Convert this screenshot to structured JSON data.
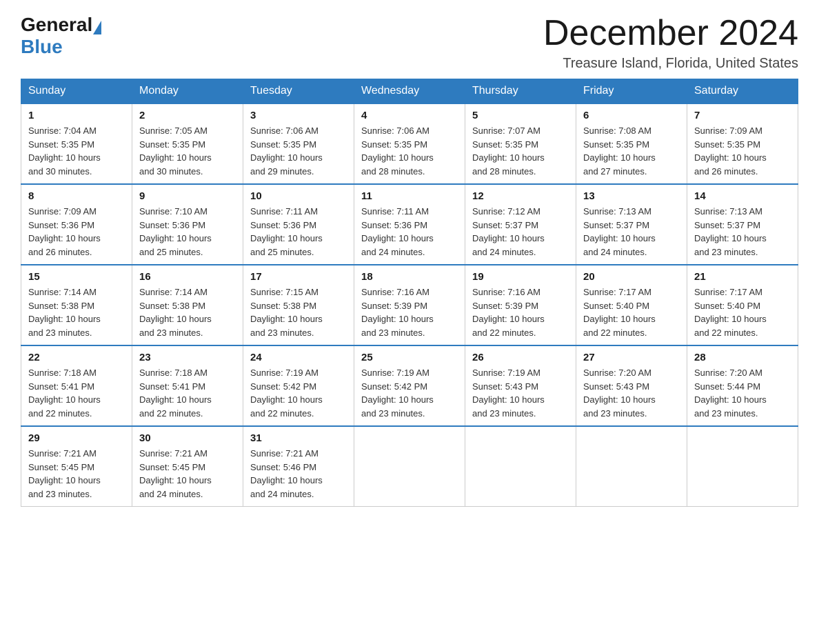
{
  "logo": {
    "general_text": "General",
    "blue_text": "Blue"
  },
  "header": {
    "month_title": "December 2024",
    "location": "Treasure Island, Florida, United States"
  },
  "weekdays": [
    "Sunday",
    "Monday",
    "Tuesday",
    "Wednesday",
    "Thursday",
    "Friday",
    "Saturday"
  ],
  "weeks": [
    [
      {
        "day": "1",
        "sunrise": "7:04 AM",
        "sunset": "5:35 PM",
        "daylight": "10 hours and 30 minutes."
      },
      {
        "day": "2",
        "sunrise": "7:05 AM",
        "sunset": "5:35 PM",
        "daylight": "10 hours and 30 minutes."
      },
      {
        "day": "3",
        "sunrise": "7:06 AM",
        "sunset": "5:35 PM",
        "daylight": "10 hours and 29 minutes."
      },
      {
        "day": "4",
        "sunrise": "7:06 AM",
        "sunset": "5:35 PM",
        "daylight": "10 hours and 28 minutes."
      },
      {
        "day": "5",
        "sunrise": "7:07 AM",
        "sunset": "5:35 PM",
        "daylight": "10 hours and 28 minutes."
      },
      {
        "day": "6",
        "sunrise": "7:08 AM",
        "sunset": "5:35 PM",
        "daylight": "10 hours and 27 minutes."
      },
      {
        "day": "7",
        "sunrise": "7:09 AM",
        "sunset": "5:35 PM",
        "daylight": "10 hours and 26 minutes."
      }
    ],
    [
      {
        "day": "8",
        "sunrise": "7:09 AM",
        "sunset": "5:36 PM",
        "daylight": "10 hours and 26 minutes."
      },
      {
        "day": "9",
        "sunrise": "7:10 AM",
        "sunset": "5:36 PM",
        "daylight": "10 hours and 25 minutes."
      },
      {
        "day": "10",
        "sunrise": "7:11 AM",
        "sunset": "5:36 PM",
        "daylight": "10 hours and 25 minutes."
      },
      {
        "day": "11",
        "sunrise": "7:11 AM",
        "sunset": "5:36 PM",
        "daylight": "10 hours and 24 minutes."
      },
      {
        "day": "12",
        "sunrise": "7:12 AM",
        "sunset": "5:37 PM",
        "daylight": "10 hours and 24 minutes."
      },
      {
        "day": "13",
        "sunrise": "7:13 AM",
        "sunset": "5:37 PM",
        "daylight": "10 hours and 24 minutes."
      },
      {
        "day": "14",
        "sunrise": "7:13 AM",
        "sunset": "5:37 PM",
        "daylight": "10 hours and 23 minutes."
      }
    ],
    [
      {
        "day": "15",
        "sunrise": "7:14 AM",
        "sunset": "5:38 PM",
        "daylight": "10 hours and 23 minutes."
      },
      {
        "day": "16",
        "sunrise": "7:14 AM",
        "sunset": "5:38 PM",
        "daylight": "10 hours and 23 minutes."
      },
      {
        "day": "17",
        "sunrise": "7:15 AM",
        "sunset": "5:38 PM",
        "daylight": "10 hours and 23 minutes."
      },
      {
        "day": "18",
        "sunrise": "7:16 AM",
        "sunset": "5:39 PM",
        "daylight": "10 hours and 23 minutes."
      },
      {
        "day": "19",
        "sunrise": "7:16 AM",
        "sunset": "5:39 PM",
        "daylight": "10 hours and 22 minutes."
      },
      {
        "day": "20",
        "sunrise": "7:17 AM",
        "sunset": "5:40 PM",
        "daylight": "10 hours and 22 minutes."
      },
      {
        "day": "21",
        "sunrise": "7:17 AM",
        "sunset": "5:40 PM",
        "daylight": "10 hours and 22 minutes."
      }
    ],
    [
      {
        "day": "22",
        "sunrise": "7:18 AM",
        "sunset": "5:41 PM",
        "daylight": "10 hours and 22 minutes."
      },
      {
        "day": "23",
        "sunrise": "7:18 AM",
        "sunset": "5:41 PM",
        "daylight": "10 hours and 22 minutes."
      },
      {
        "day": "24",
        "sunrise": "7:19 AM",
        "sunset": "5:42 PM",
        "daylight": "10 hours and 22 minutes."
      },
      {
        "day": "25",
        "sunrise": "7:19 AM",
        "sunset": "5:42 PM",
        "daylight": "10 hours and 23 minutes."
      },
      {
        "day": "26",
        "sunrise": "7:19 AM",
        "sunset": "5:43 PM",
        "daylight": "10 hours and 23 minutes."
      },
      {
        "day": "27",
        "sunrise": "7:20 AM",
        "sunset": "5:43 PM",
        "daylight": "10 hours and 23 minutes."
      },
      {
        "day": "28",
        "sunrise": "7:20 AM",
        "sunset": "5:44 PM",
        "daylight": "10 hours and 23 minutes."
      }
    ],
    [
      {
        "day": "29",
        "sunrise": "7:21 AM",
        "sunset": "5:45 PM",
        "daylight": "10 hours and 23 minutes."
      },
      {
        "day": "30",
        "sunrise": "7:21 AM",
        "sunset": "5:45 PM",
        "daylight": "10 hours and 24 minutes."
      },
      {
        "day": "31",
        "sunrise": "7:21 AM",
        "sunset": "5:46 PM",
        "daylight": "10 hours and 24 minutes."
      },
      null,
      null,
      null,
      null
    ]
  ],
  "labels": {
    "sunrise": "Sunrise:",
    "sunset": "Sunset:",
    "daylight": "Daylight:"
  }
}
